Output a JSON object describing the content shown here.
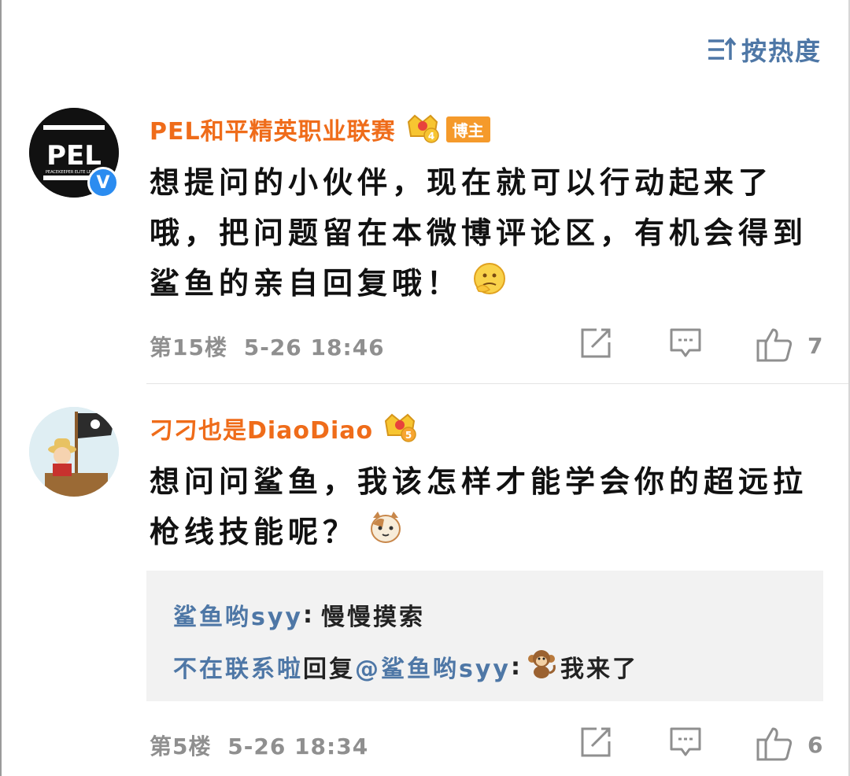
{
  "sort": {
    "label": "按热度",
    "icon": "sort-icon"
  },
  "comments": [
    {
      "username": "PEL和平精英职业联赛",
      "badge": "博主",
      "crown_level": "4",
      "avatar_text": "PEL",
      "avatar_subtext": "PEACEKEEPER ELITE LEAGUE",
      "verified": "V",
      "text": "想提问的小伙伴，现在就可以行动起来了哦，把问题留在本微博评论区，有机会得到鲨鱼的亲自回复哦！",
      "emoji": "thinking-face-icon",
      "floor": "第15楼",
      "time": "5-26 18:46",
      "likes": "7"
    },
    {
      "username": "刁刁也是DiaoDiao",
      "crown_level": "5",
      "text": "想问问鲨鱼，我该怎样才能学会你的超远拉枪线技能呢？",
      "emoji": "cat-face-icon",
      "replies": [
        {
          "author": "鲨鱼哟syy",
          "separator": ":",
          "text": "慢慢摸索"
        },
        {
          "author": "不在联系啦",
          "reply_word": "回复",
          "mention": "@鲨鱼哟syy",
          "separator": ":",
          "text": "我来了",
          "emoji": "monkey-icon"
        }
      ],
      "floor": "第5楼",
      "time": "5-26 18:34",
      "likes": "6"
    }
  ],
  "colors": {
    "username": "#ef6c1a",
    "link": "#4e77a6",
    "meta": "#8f8f8f",
    "badge": "#f59a2b",
    "verified": "#2b8cf0",
    "reply_bg": "#f2f2f2"
  }
}
